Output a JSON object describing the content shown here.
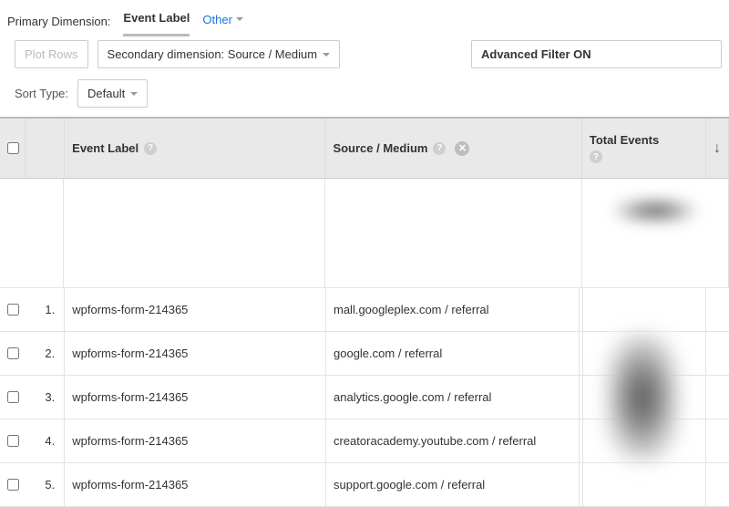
{
  "primaryDimension": {
    "label": "Primary Dimension:",
    "active": "Event Label",
    "other": "Other"
  },
  "controls": {
    "plotRows": "Plot Rows",
    "secondaryDimension": "Secondary dimension: Source / Medium",
    "filter": "Advanced Filter ON"
  },
  "sort": {
    "label": "Sort Type:",
    "value": "Default"
  },
  "headers": {
    "eventLabel": "Event Label",
    "sourceMedium": "Source / Medium",
    "totalEvents": "Total Events"
  },
  "rows": [
    {
      "idx": "1.",
      "label": "wpforms-form-214365",
      "source": "mall.googleplex.com / referral"
    },
    {
      "idx": "2.",
      "label": "wpforms-form-214365",
      "source": "google.com / referral"
    },
    {
      "idx": "3.",
      "label": "wpforms-form-214365",
      "source": "analytics.google.com / referral"
    },
    {
      "idx": "4.",
      "label": "wpforms-form-214365",
      "source": "creatoracademy.youtube.com / referral"
    },
    {
      "idx": "5.",
      "label": "wpforms-form-214365",
      "source": "support.google.com / referral"
    }
  ]
}
